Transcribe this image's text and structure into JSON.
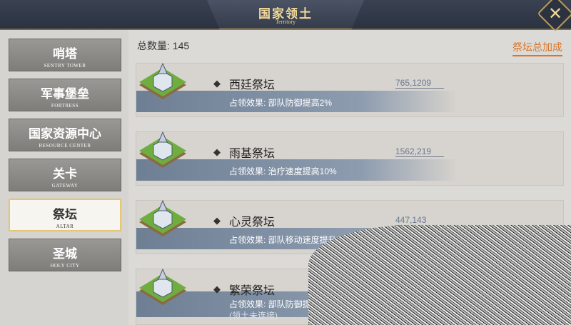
{
  "header": {
    "title_cn": "国家领土",
    "title_en": "Territory",
    "close_label": "✕"
  },
  "sidebar": {
    "items": [
      {
        "cn": "哨塔",
        "en": "SENTRY TOWER"
      },
      {
        "cn": "军事堡垒",
        "en": "FORTRESS"
      },
      {
        "cn": "国家资源中心",
        "en": "RESOURCE CENTER"
      },
      {
        "cn": "关卡",
        "en": "GATEWAY"
      },
      {
        "cn": "祭坛",
        "en": "ALTAR"
      },
      {
        "cn": "圣城",
        "en": "HOLY CITY"
      }
    ],
    "active_index": 4
  },
  "main": {
    "total_label": "总数量: 145",
    "bonus_link": "祭坛总加成",
    "altars": [
      {
        "name": "西廷祭坛",
        "coords": "765,1209",
        "effect": "占领效果: 部队防御提高2%",
        "note": ""
      },
      {
        "name": "雨基祭坛",
        "coords": "1562,219",
        "effect": "占领效果: 治疗速度提高10%",
        "note": ""
      },
      {
        "name": "心灵祭坛",
        "coords": "447,143",
        "effect": "占领效果: 部队移动速度提升3%",
        "note": ""
      },
      {
        "name": "繁荣祭坛",
        "coords": "",
        "effect": "占领效果: 部队防御提",
        "note": "(领土未连接)"
      }
    ]
  },
  "colors": {
    "accent": "#d8762c",
    "header": "#2b3240",
    "gold": "#f3d99a"
  }
}
